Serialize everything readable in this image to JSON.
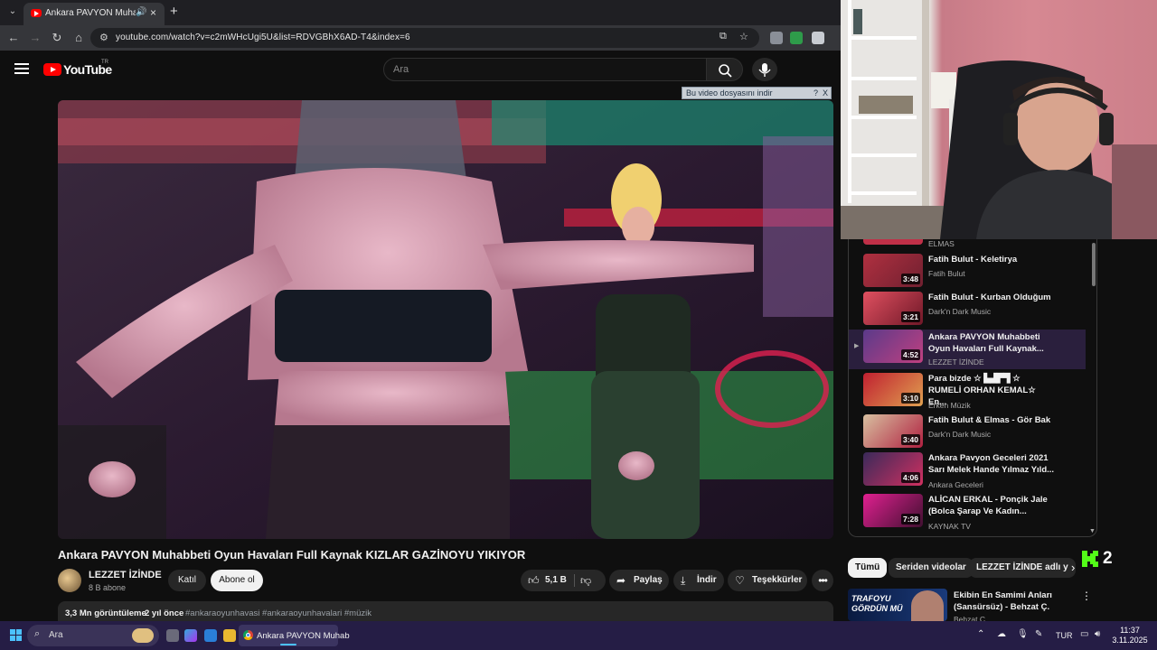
{
  "browser": {
    "tab_title": "Ankara PAVYON Muhabbeti",
    "tab_close": "×",
    "tab_audio": "🔊",
    "new_tab": "+",
    "url": "youtube.com/watch?v=c2mWHcUgi5U&list=RDVGBhX6AD-T4&index=6"
  },
  "youtube": {
    "logo_text": "YouTube",
    "logo_region": "TR",
    "search_placeholder": "Ara",
    "download_bar": "Bu video dosyasını indir",
    "download_help": "?",
    "download_close": "X",
    "video_title": "Ankara PAVYON Muhabbeti Oyun Havaları Full Kaynak KIZLAR GAZİNOYU YIKIYOR",
    "channel_name": "LEZZET İZİNDE",
    "channel_subs": "8 B abone",
    "join_label": "Katıl",
    "subscribe_label": "Abone ol",
    "like_count": "5,1 B",
    "share_label": "Paylaş",
    "download_label": "İndir",
    "thanks_label": "Teşekkürler",
    "views": "3,3 Mn görüntüleme",
    "ago": "2 yıl önce",
    "tags": "#ankaraoyunhavasi #ankaraoyunhavalari #müzik"
  },
  "playlist": {
    "partial_channel": "ELMAS",
    "items": [
      {
        "title": "Fatih Bulut - Keletirya",
        "channel": "Fatih Bulut",
        "duration": "3:48"
      },
      {
        "title": "Fatih Bulut - Kurban Olduğum",
        "channel": "Dark'n Dark Music",
        "duration": "3:21"
      },
      {
        "title": "Ankara PAVYON Muhabbeti Oyun Havaları Full Kaynak...",
        "channel": "LEZZET İZİNDE",
        "duration": "4:52",
        "active": true
      },
      {
        "title": "Para bizde ☆ ▙▟▛▜ ☆ RUMELİ ORHAN KEMAL☆ En...",
        "channel": "Erken Müzik",
        "duration": "3:10"
      },
      {
        "title": "Fatih Bulut & Elmas - Gör Bak",
        "channel": "Dark'n Dark Music",
        "duration": "3:40"
      },
      {
        "title": "Ankara Pavyon Geceleri 2021 Sarı Melek Hande Yılmaz Yıld...",
        "channel": "Ankara Geceleri",
        "duration": "4:06"
      },
      {
        "title": "ALİCAN ERKAL - Ponçik Jale (Bolca Şarap Ve Kadın...",
        "channel": "KAYNAK TV",
        "duration": "7:28"
      }
    ]
  },
  "chips": [
    "Tümü",
    "Seriden videolar",
    "LEZZET İZİNDE adlı y"
  ],
  "kick_badge": "2",
  "recommended": {
    "title": "Ekibin En Samimi Anları (Sansürsüz) - Behzat Ç.",
    "channel": "Behzat Ç.",
    "thumb_text": "TRAFOYU GÖRDÜN MÜ"
  },
  "taskbar": {
    "search_label": "Ara",
    "chrome_label": "Ankara PAVYON Muhab",
    "lang": "TUR",
    "time": "11:37",
    "date": "3.11.2025"
  },
  "colors": {
    "yt_red": "#ff0000",
    "yt_bg": "#0f0f0f",
    "taskbar_bg": "#251d45",
    "active_playlist_bg": "#2a1f3d",
    "kick_green": "#53fc18"
  }
}
